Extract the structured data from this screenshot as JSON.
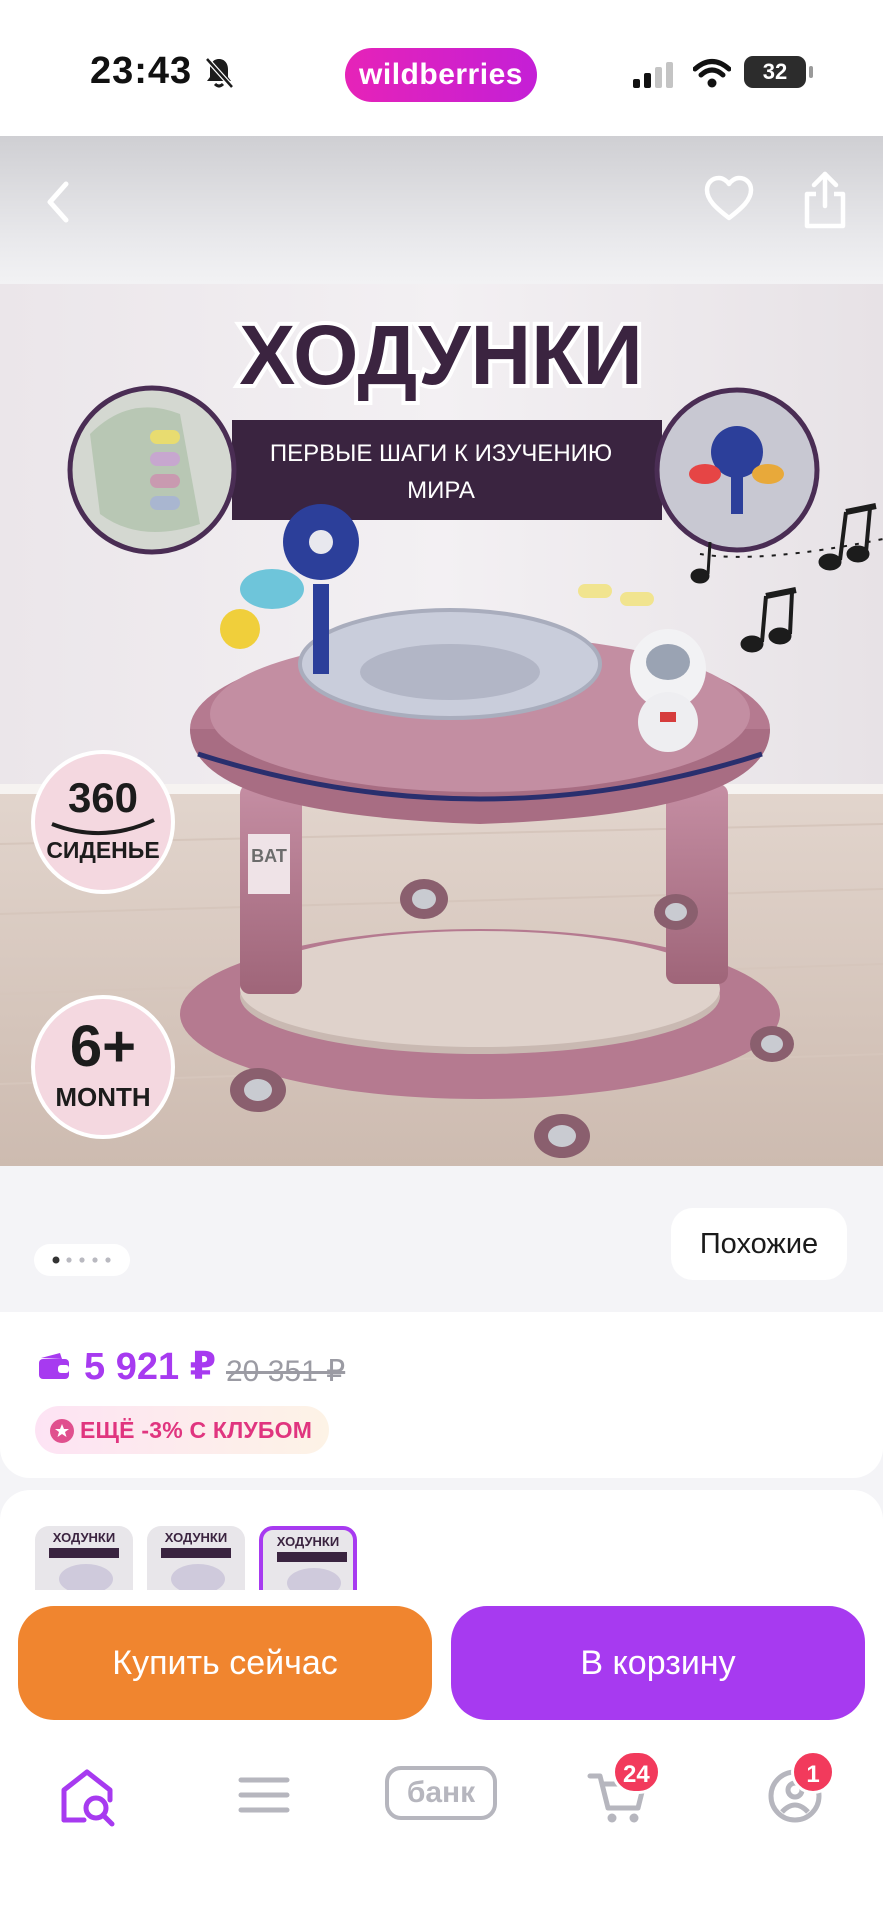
{
  "status_bar": {
    "time": "23:43",
    "app_badge": "wildberries",
    "battery_level": "32",
    "icons": [
      "bell-slash-icon",
      "cellular-signal-icon",
      "wifi-icon",
      "battery-icon"
    ]
  },
  "product_header": {
    "icons": [
      "back-arrow-icon",
      "heart-icon",
      "share-icon"
    ]
  },
  "product_image": {
    "headline": "ХОДУНКИ",
    "tagline_line1": "ПЕРВЫЕ ШАГИ К ИЗУЧЕНИЮ",
    "tagline_line2": "МИРА",
    "badge_360_number": "360",
    "badge_360_label": "СИДЕНЬЕ",
    "badge_age_number": "6+",
    "badge_age_label": "MONTH",
    "body_print": "BAT",
    "carousel_total": 5,
    "carousel_active": 1
  },
  "similar_button": "Похожие",
  "price_block": {
    "current_price": "5 921 ₽",
    "old_price": "20 351 ₽",
    "club_offer": "ЕЩЁ -3% С КЛУБОМ"
  },
  "variants": [
    {
      "title": "ХОДУНКИ",
      "selected": false
    },
    {
      "title": "ХОДУНКИ",
      "selected": false
    },
    {
      "title": "ХОДУНКИ",
      "selected": true
    }
  ],
  "actions": {
    "buy_now": "Купить сейчас",
    "add_to_cart": "В корзину"
  },
  "tabbar": {
    "items": [
      "home-search-icon",
      "catalog-menu-icon",
      "bank",
      "cart-icon",
      "profile-icon"
    ],
    "bank_label": "банк",
    "cart_count": "24",
    "profile_count": "1"
  },
  "colors": {
    "brand_purple": "#a73af0",
    "buy_orange": "#f0852f",
    "badge_red": "#f23a5c",
    "walker_pink": "#b57a90"
  }
}
